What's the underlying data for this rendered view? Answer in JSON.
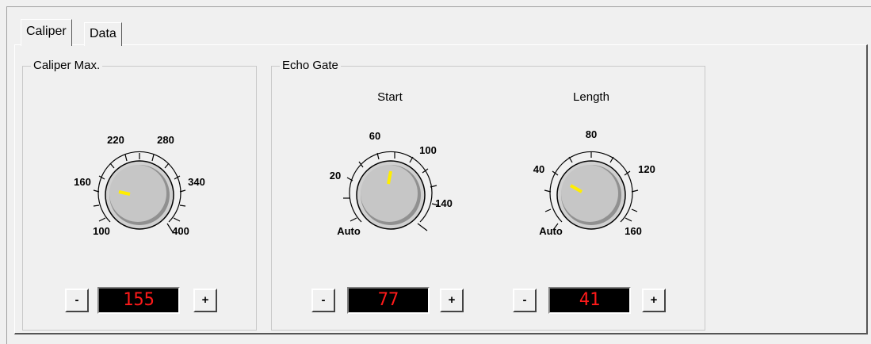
{
  "tabs": [
    {
      "label": "Caliper",
      "active": true
    },
    {
      "label": "Data",
      "active": false
    }
  ],
  "caliper_max": {
    "group_title": "Caliper Max.",
    "knob": {
      "ticks": [
        "100",
        "160",
        "220",
        "280",
        "340",
        "400"
      ],
      "value": 155
    },
    "minus_label": "-",
    "plus_label": "+",
    "display_value": "155"
  },
  "echo_gate": {
    "group_title": "Echo Gate",
    "start": {
      "label": "Start",
      "knob": {
        "ticks": [
          "Auto",
          "20",
          "60",
          "100",
          "140"
        ],
        "value": 77
      },
      "minus_label": "-",
      "plus_label": "+",
      "display_value": "77"
    },
    "length": {
      "label": "Length",
      "knob": {
        "ticks": [
          "Auto",
          "40",
          "80",
          "120",
          "160"
        ],
        "value": 41
      },
      "minus_label": "-",
      "plus_label": "+",
      "display_value": "41"
    }
  },
  "colors": {
    "indicator": "#ffee00",
    "display_text": "#ff1a1a",
    "display_bg": "#000000"
  }
}
